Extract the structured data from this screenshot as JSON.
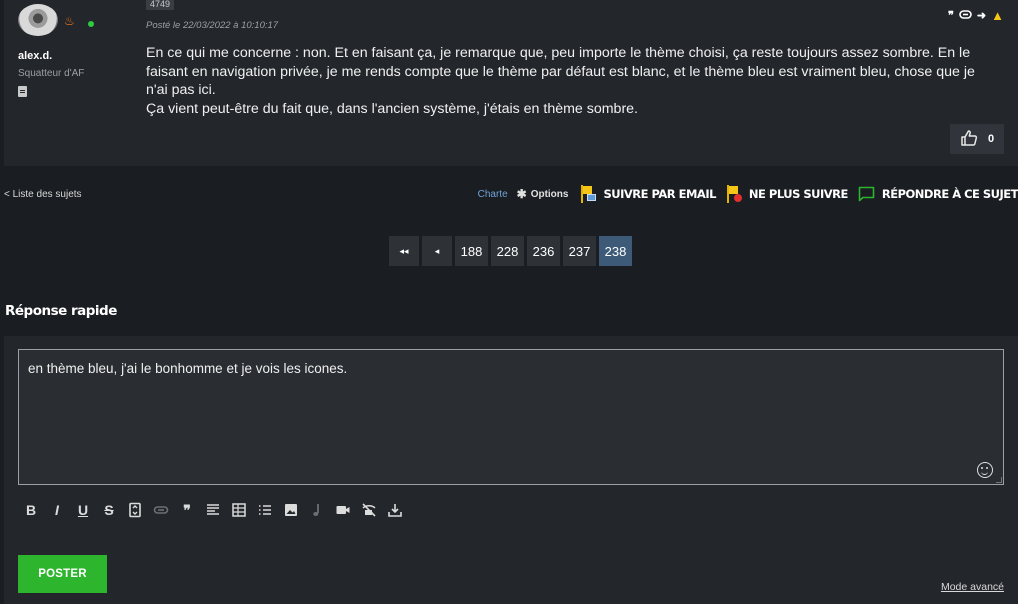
{
  "post": {
    "number": "4749",
    "date": "Posté le 22/03/2022 à 10:10:17",
    "author": {
      "name": "alex.d.",
      "rank": "Squatteur d'AF"
    },
    "body_lines": [
      "En ce qui me concerne : non. Et en faisant ça, je remarque que, peu importe le thème choisi, ça reste toujours assez sombre. En le faisant en navigation privée, je me rends compte que le thème par défaut est blanc, et le thème bleu est vraiment bleu, chose que je n'ai pas ici.",
      "Ça vient peut-être du fait que, dans l'ancien système, j'étais en thème sombre."
    ],
    "actions": {
      "quote": "❞",
      "link": "⊖",
      "share": "➜",
      "report": "▲"
    },
    "likes": "0"
  },
  "topic_bar": {
    "back_label": "< Liste des sujets",
    "charte_label": "Charte",
    "options_label": "Options",
    "follow_email_label": "SUIVRE PAR EMAIL",
    "unfollow_label": "NE PLUS SUIVRE",
    "reply_label": "RÉPONDRE À CE SUJET"
  },
  "pagination": {
    "first": "◂◂",
    "prev": "◂",
    "pages": [
      "188",
      "228",
      "236",
      "237",
      "238"
    ],
    "current": "238"
  },
  "quick_reply": {
    "title": "Réponse rapide",
    "editor_value": "en thème bleu, j'ai le bonhomme et je vois les icones.",
    "toolbar": {
      "bold": "B",
      "italic": "I",
      "underline": "U",
      "strike": "S",
      "quote": "❞"
    },
    "post_label": "POSTER",
    "advanced_label": "Mode avancé"
  },
  "colors": {
    "background": "#1a1d22",
    "panel": "#23262b",
    "accent_green": "#2db52d",
    "page_current": "#3d5a78",
    "link_blue": "#6fa3d4",
    "flag_yellow": "#f5c518"
  }
}
